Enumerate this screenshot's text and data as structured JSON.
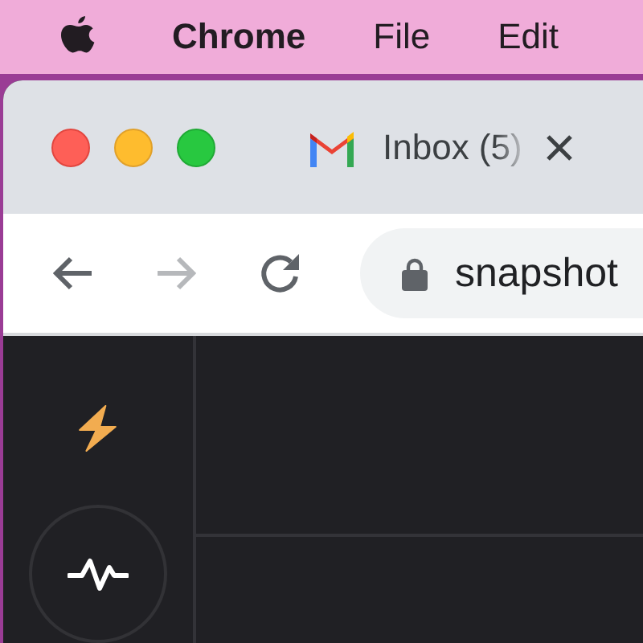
{
  "menu_bar": {
    "items": [
      {
        "label": "Chrome",
        "kind": "app"
      },
      {
        "label": "File",
        "kind": "menu"
      },
      {
        "label": "Edit",
        "kind": "menu"
      }
    ]
  },
  "tab": {
    "title": "Inbox (5)"
  },
  "toolbar": {
    "buttons": [
      {
        "kind": "back",
        "disabled": false
      },
      {
        "kind": "forward",
        "disabled": true
      },
      {
        "kind": "reload",
        "disabled": false
      }
    ],
    "address": "snapshot"
  }
}
